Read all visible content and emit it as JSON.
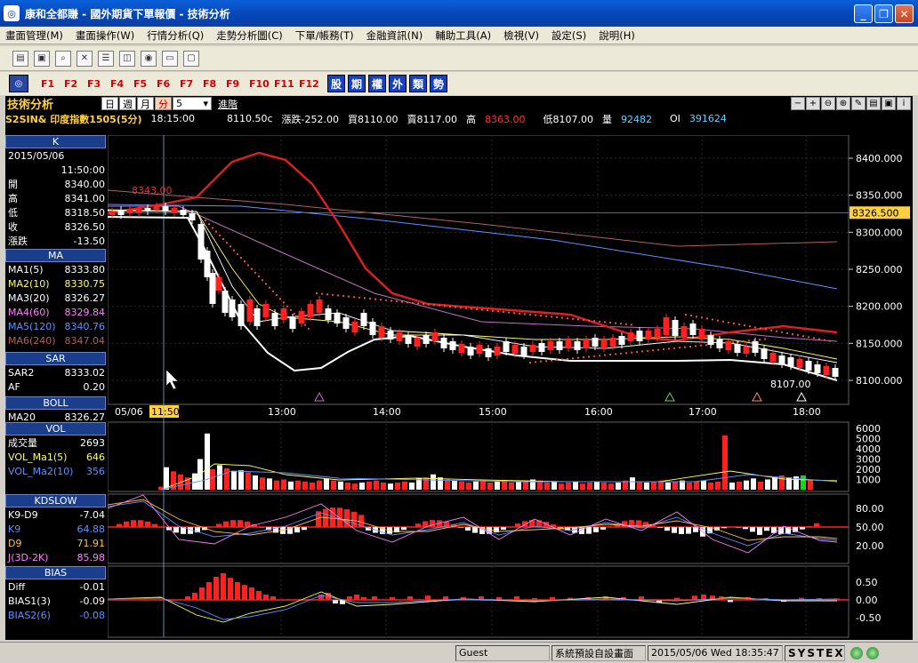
{
  "window": {
    "title": "康和全都賺 - 國外期貨下單報價 - 技術分析"
  },
  "menu": [
    "畫面管理(M)",
    "畫面操作(W)",
    "行情分析(Q)",
    "走勢分析圖(C)",
    "下單/帳務(T)",
    "金融資訊(N)",
    "輔助工具(A)",
    "檢視(V)",
    "設定(S)",
    "說明(H)"
  ],
  "fkeys": [
    "F1",
    "F2",
    "F3",
    "F4",
    "F5",
    "F6",
    "F7",
    "F8",
    "F9",
    "F10",
    "F11",
    "F12"
  ],
  "cnbuttons": [
    "股",
    "期",
    "權",
    "外",
    "類",
    "勢"
  ],
  "header": {
    "title": "技術分析",
    "periods": [
      "日",
      "週",
      "月",
      "分"
    ],
    "period_value": "5",
    "advanced": "進階",
    "symbol": "S2SIN& 印度指數1505(5分)",
    "time": "18:15:00",
    "price": "8110.50c",
    "change": "漲跌-252.00",
    "bid": "買8110.00",
    "ask": "賣8117.00",
    "high_label": "高",
    "high": "8363.00",
    "low": "低8107.00",
    "vol_label": "量",
    "vol": "92482",
    "oi_label": "OI",
    "oi": "391624"
  },
  "panel_k": {
    "title": "K",
    "date": "2015/05/06",
    "time": "11:50:00",
    "rows": [
      {
        "label": "開",
        "value": "8340.00"
      },
      {
        "label": "高",
        "value": "8341.00"
      },
      {
        "label": "低",
        "value": "8318.50"
      },
      {
        "label": "收",
        "value": "8326.50"
      },
      {
        "label": "漲跌",
        "value": "-13.50"
      }
    ]
  },
  "panel_ma": {
    "title": "MA",
    "rows": [
      {
        "label": "MA1(5)",
        "value": "8333.80",
        "color": "#ffffff"
      },
      {
        "label": "MA2(10)",
        "value": "8330.75",
        "color": "#ffff60"
      },
      {
        "label": "MA3(20)",
        "value": "8326.27",
        "color": "#ffffff"
      },
      {
        "label": "MA4(60)",
        "value": "8329.84",
        "color": "#ff80ff"
      },
      {
        "label": "MA5(120)",
        "value": "8340.76",
        "color": "#6090ff"
      },
      {
        "label": "MA6(240)",
        "value": "8347.04",
        "color": "#b06060"
      }
    ]
  },
  "panel_sar": {
    "title": "SAR",
    "rows": [
      {
        "label": "SAR2",
        "value": "8333.02"
      },
      {
        "label": "AF",
        "value": "0.20"
      }
    ]
  },
  "panel_boll": {
    "title": "BOLL",
    "rows": [
      {
        "label": "MA20",
        "value": "8326.27"
      }
    ]
  },
  "panel_vol": {
    "title": "VOL",
    "rows": [
      {
        "label": "成交量",
        "value": "2693",
        "color": "#ffffff"
      },
      {
        "label": "VOL_Ma1(5)",
        "value": "646",
        "color": "#ffff60"
      },
      {
        "label": "VOL_Ma2(10)",
        "value": "356",
        "color": "#6090ff"
      }
    ]
  },
  "panel_kd": {
    "title": "KDSLOW",
    "rows": [
      {
        "label": "K9-D9",
        "value": "-7.04",
        "color": "#ffffff"
      },
      {
        "label": "K9",
        "value": "64.88",
        "color": "#6090ff"
      },
      {
        "label": "D9",
        "value": "71.91",
        "color": "#ffc040"
      },
      {
        "label": "J(3D-2K)",
        "value": "85.98",
        "color": "#ff80ff"
      }
    ]
  },
  "panel_bias": {
    "title": "BIAS",
    "rows": [
      {
        "label": "Diff",
        "value": "-0.01",
        "color": "#ffffff"
      },
      {
        "label": "BIAS1(3)",
        "value": "-0.09",
        "color": "#ffffff"
      },
      {
        "label": "BIAS2(6)",
        "value": "-0.08",
        "color": "#6090ff"
      }
    ]
  },
  "price_axis": [
    "8400.000",
    "8350.000",
    "8300.000",
    "8250.000",
    "8200.000",
    "8150.000",
    "8100.000"
  ],
  "price_current": "8326.500",
  "price_high_mark": "8343.00",
  "price_low_mark": "8107.00",
  "time_axis": {
    "date": "05/06",
    "cursor": "11:50",
    "ticks": [
      "13:00",
      "14:00",
      "15:00",
      "16:00",
      "17:00",
      "18:00"
    ]
  },
  "vol_axis": [
    "6000",
    "5000",
    "4000",
    "3000",
    "2000",
    "1000"
  ],
  "kd_axis": [
    "80.00",
    "50.00",
    "20.00"
  ],
  "bias_axis": [
    "0.50",
    "0.00",
    "-0.50"
  ],
  "status": {
    "user": "Guest",
    "layout": "系統預設自設畫面",
    "datetime": "2015/05/06 Wed 18:35:47",
    "brand": "SYSTEX"
  },
  "colors": {
    "up": "#ff2020",
    "down": "#ffffff",
    "accent": "#ffd040"
  }
}
